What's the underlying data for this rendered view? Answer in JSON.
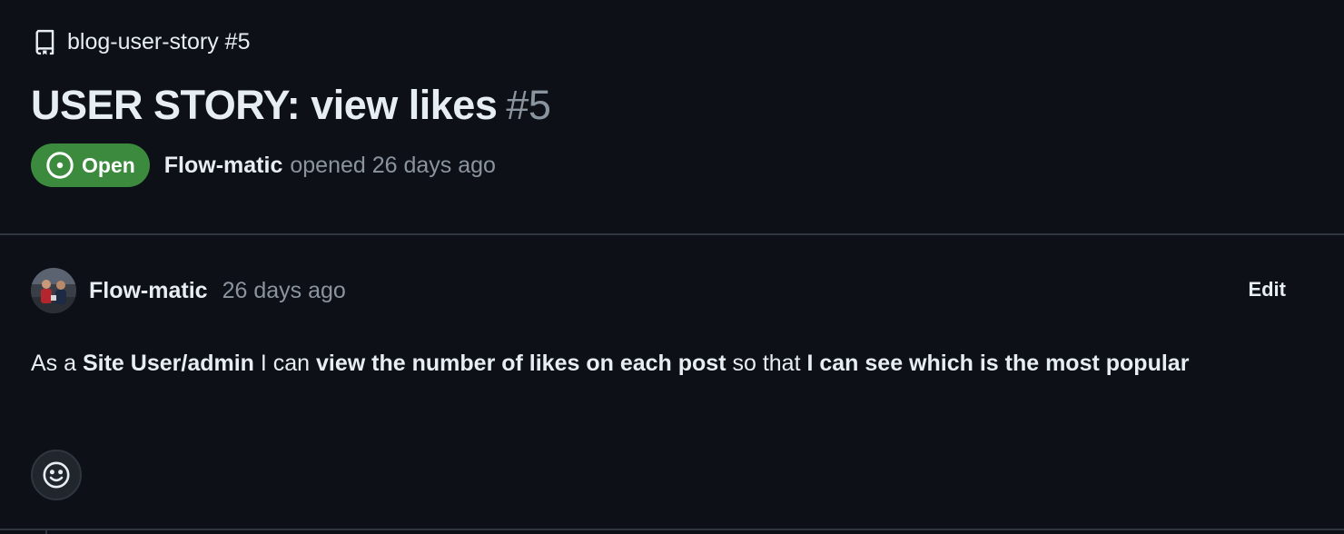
{
  "repo": {
    "icon": "repo-icon",
    "name_number": "blog-user-story #5"
  },
  "issue": {
    "title": "USER STORY: view likes",
    "number": "#5",
    "state": "Open",
    "state_icon": "issue-opened-icon",
    "state_color": "#3b8a3e",
    "author": "Flow-matic",
    "opened_text": "opened 26 days ago"
  },
  "comment": {
    "author": "Flow-matic",
    "timestamp": "26 days ago",
    "edit_label": "Edit",
    "body": {
      "t1": "As a ",
      "b1": "Site User/admin",
      "t2": " I can ",
      "b2": "view the number of likes on each post",
      "t3": " so that ",
      "b3": "I can see which is the most popular"
    },
    "reaction_icon": "smiley-icon"
  },
  "colors": {
    "background": "#0d1117",
    "text": "#e6edf3",
    "muted": "#8b949e",
    "border": "#30363d"
  }
}
